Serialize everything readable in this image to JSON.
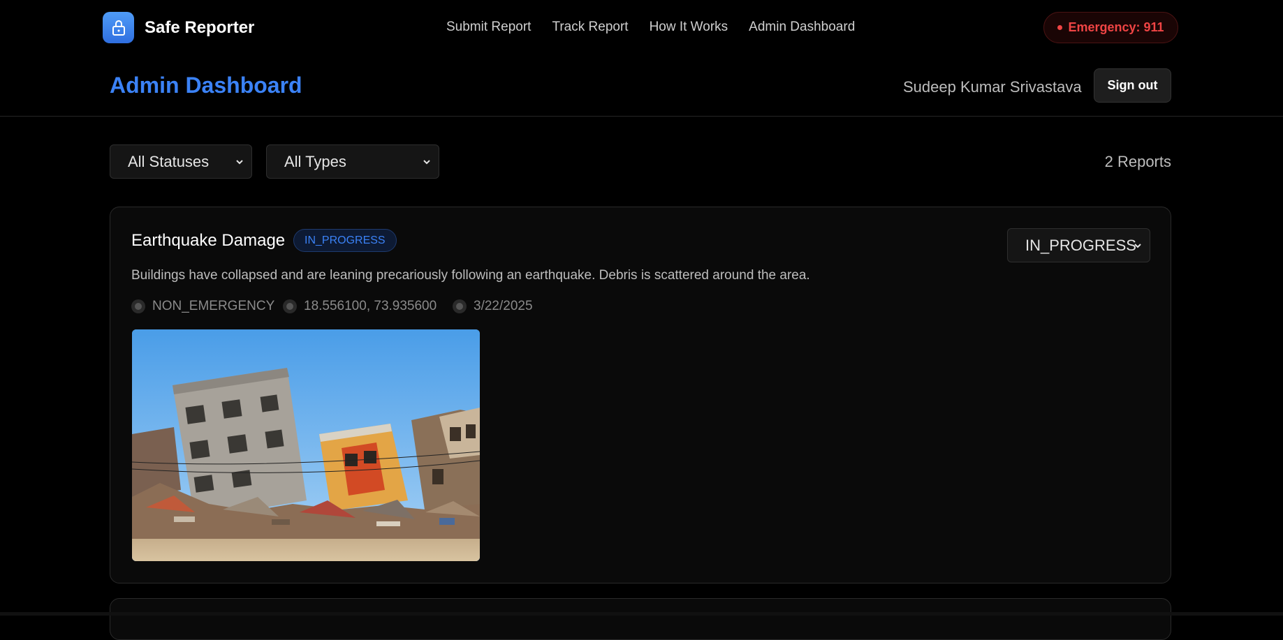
{
  "brand": {
    "name": "Safe Reporter",
    "logo_icon": "lock-icon",
    "accent": "#3b82f6"
  },
  "nav": {
    "links": [
      {
        "label": "Submit Report"
      },
      {
        "label": "Track Report"
      },
      {
        "label": "How It Works"
      },
      {
        "label": "Admin Dashboard"
      }
    ],
    "emergency_label": "Emergency: 911",
    "emergency_color": "#ef4444"
  },
  "header": {
    "title": "Admin Dashboard",
    "user_name": "Sudeep Kumar Srivastava",
    "signout_label": "Sign out"
  },
  "filters": {
    "status": {
      "selected": "All Statuses"
    },
    "type": {
      "selected": "All Types"
    },
    "count_label": "2 Reports"
  },
  "reports": [
    {
      "title": "Earthquake Damage",
      "status_badge": "IN_PROGRESS",
      "status_select": "IN_PROGRESS",
      "description": "Buildings have collapsed and are leaning precariously following an earthquake. Debris is scattered around the area.",
      "type": "NON_EMERGENCY",
      "coordinates": "18.556100, 73.935600",
      "date": "3/22/2025",
      "image": "collapsed-buildings-photo"
    }
  ]
}
